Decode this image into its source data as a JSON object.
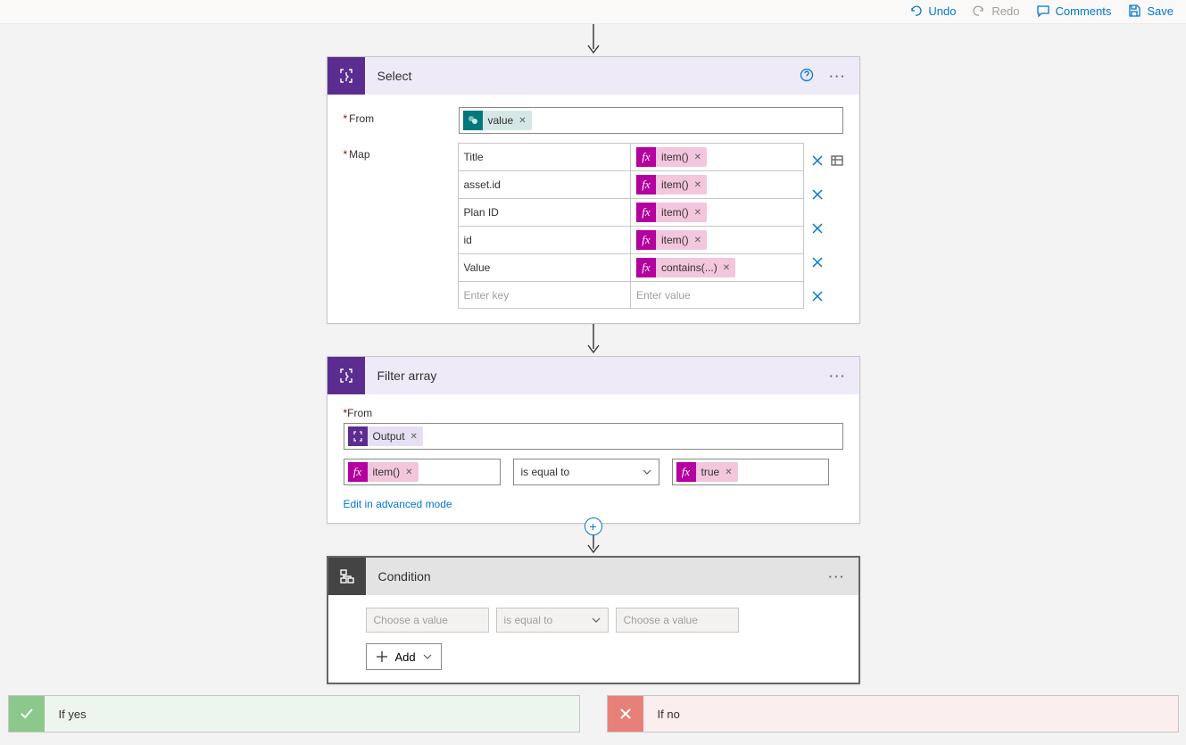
{
  "toolbar": {
    "undo_label": "Undo",
    "redo_label": "Redo",
    "comments_label": "Comments",
    "save_label": "Save"
  },
  "select_card": {
    "title": "Select",
    "from_label": "From",
    "map_label": "Map",
    "from_token": "value",
    "map_rows": [
      {
        "key": "Title",
        "value_label": "item()"
      },
      {
        "key": "asset.id",
        "value_label": "item()"
      },
      {
        "key": "Plan ID",
        "value_label": "item()"
      },
      {
        "key": "id",
        "value_label": "item()"
      },
      {
        "key": "Value",
        "value_label": "contains(...)"
      }
    ],
    "enter_key_placeholder": "Enter key",
    "enter_value_placeholder": "Enter value"
  },
  "filter_card": {
    "title": "Filter array",
    "from_label": "From",
    "from_token": "Output",
    "left_token": "item()",
    "operator": "is equal to",
    "right_token": "true",
    "advanced_link": "Edit in advanced mode"
  },
  "condition_card": {
    "title": "Condition",
    "value_placeholder": "Choose a value",
    "operator": "is equal to",
    "add_label": "Add"
  },
  "branches": {
    "yes_label": "If yes",
    "no_label": "If no"
  }
}
